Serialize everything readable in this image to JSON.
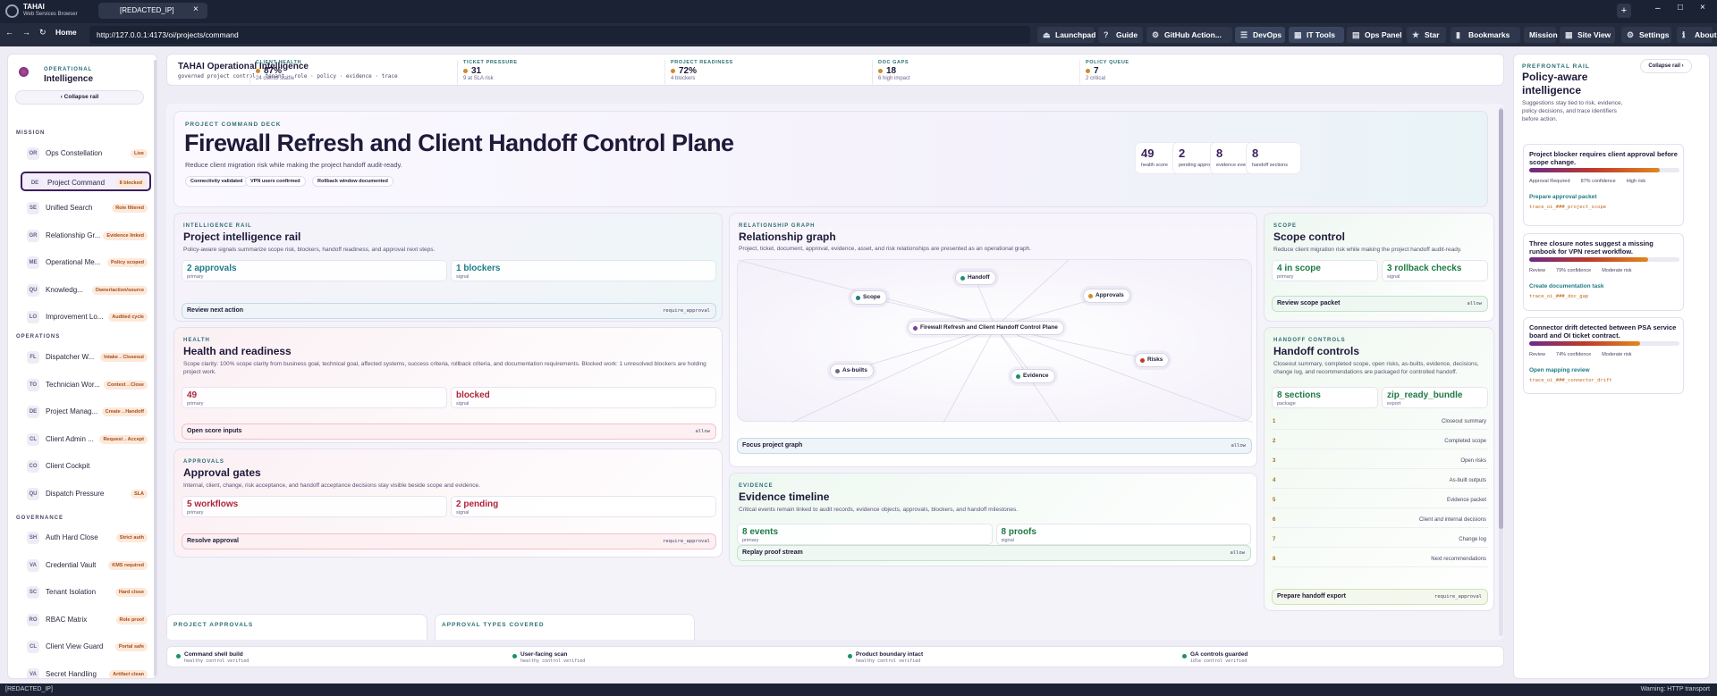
{
  "browser": {
    "app_name": "TAHAI",
    "app_sub": "Web Services Browser",
    "tab_title": "[REDACTED_IP]",
    "home": "Home",
    "url": "http://127.0.0.1:4173/oi/projects/command",
    "buttons": [
      "Launchpad",
      "Guide",
      "GitHub Action...",
      "DevOps",
      "IT Tools",
      "Ops Panel",
      "Star",
      "Bookmarks",
      "Mission",
      "Site View",
      "Settings",
      "About"
    ],
    "status_left": "[REDACTED_IP]",
    "status_right": "Warning: HTTP transport"
  },
  "sidebar": {
    "brand_small": "OPERATIONAL",
    "brand_big": "Intelligence",
    "collapse": "Collapse rail",
    "sections": {
      "mission": "MISSION",
      "operations": "OPERATIONS",
      "governance": "GOVERNANCE"
    },
    "mission": [
      {
        "ab": "OR",
        "label": "Ops Constellation",
        "badge": "Live"
      },
      {
        "ab": "DE",
        "label": "Project Command",
        "badge": "8 blocked"
      },
      {
        "ab": "SE",
        "label": "Unified Search",
        "badge": "Role filtered"
      },
      {
        "ab": "GR",
        "label": "Relationship Gr...",
        "badge": "Evidence linked"
      },
      {
        "ab": "ME",
        "label": "Operational Me...",
        "badge": "Policy scoped"
      },
      {
        "ab": "QU",
        "label": "Knowledg...",
        "badge": "Owner/action/source"
      },
      {
        "ab": "LO",
        "label": "Improvement Lo...",
        "badge": "Audited cycle"
      }
    ],
    "operations": [
      {
        "ab": "FL",
        "label": "Dispatcher W...",
        "badge": "Intake→Closeout"
      },
      {
        "ab": "TO",
        "label": "Technician Wor...",
        "badge": "Context→Close"
      },
      {
        "ab": "DE",
        "label": "Project Manag...",
        "badge": "Create→Handoff"
      },
      {
        "ab": "CL",
        "label": "Client Admin ...",
        "badge": "Request→Accept"
      },
      {
        "ab": "CO",
        "label": "Client Cockpit",
        "badge": ""
      },
      {
        "ab": "QU",
        "label": "Dispatch Pressure",
        "badge": "SLA"
      }
    ],
    "governance": [
      {
        "ab": "SH",
        "label": "Auth Hard Close",
        "badge": "Strict auth"
      },
      {
        "ab": "VA",
        "label": "Credential Vault",
        "badge": "KMS required"
      },
      {
        "ab": "SC",
        "label": "Tenant Isolation",
        "badge": "Hard close"
      },
      {
        "ab": "RO",
        "label": "RBAC Matrix",
        "badge": "Role proof"
      },
      {
        "ab": "CL",
        "label": "Client View Guard",
        "badge": "Portal safe"
      },
      {
        "ab": "VA",
        "label": "Secret Handling",
        "badge": "Artifact clean"
      }
    ]
  },
  "header": {
    "title": "TAHAI Operational Intelligence",
    "subtitle": "governed project control · tenant · role · policy · evidence · trace",
    "kpis": [
      {
        "k": "CLIENT HEALTH",
        "v": "87%",
        "s": "24 clients stable"
      },
      {
        "k": "TICKET PRESSURE",
        "v": "31",
        "s": "9 at SLA risk"
      },
      {
        "k": "PROJECT READINESS",
        "v": "72%",
        "s": "4 blockers"
      },
      {
        "k": "DOC GAPS",
        "v": "18",
        "s": "6 high impact"
      },
      {
        "k": "POLICY QUEUE",
        "v": "7",
        "s": "2 critical"
      }
    ]
  },
  "hero": {
    "cap": "PROJECT COMMAND DECK",
    "title": "Firewall Refresh and Client Handoff Control Plane",
    "desc": "Reduce client migration risk while making the project handoff audit-ready.",
    "chips": [
      "Connectivity validated",
      "VPN users confirmed",
      "Rollback window documented"
    ],
    "stats": [
      {
        "v": "49",
        "l": "health score"
      },
      {
        "v": "2",
        "l": "pending approvals"
      },
      {
        "v": "8",
        "l": "evidence events"
      },
      {
        "v": "8",
        "l": "handoff sections"
      }
    ]
  },
  "intel": {
    "cap": "INTELLIGENCE RAIL",
    "title": "Project intelligence rail",
    "desc": "Policy-aware signals summarize scope risk, blockers, handoff readiness, and approval next steps.",
    "m1v": "2 approvals",
    "m1s": "primary",
    "m2v": "1 blockers",
    "m2s": "signal",
    "action": "Review next action",
    "decision": "require_approval"
  },
  "health": {
    "cap": "HEALTH",
    "title": "Health and readiness",
    "desc": "Scope clarity: 100% scope clarity from business goal, technical goal, affected systems, success criteria, rollback criteria, and documentation requirements. Blocked work: 1 unresolved blockers are holding project work.",
    "m1v": "49",
    "m1s": "primary",
    "m2v": "blocked",
    "m2s": "signal",
    "action": "Open score inputs",
    "decision": "allow"
  },
  "approvals": {
    "cap": "APPROVALS",
    "title": "Approval gates",
    "desc": "Internal, client, change, risk acceptance, and handoff acceptance decisions stay visible beside scope and evidence.",
    "m1v": "5 workflows",
    "m1s": "primary",
    "m2v": "2 pending",
    "m2s": "signal",
    "action": "Resolve approval",
    "decision": "require_approval"
  },
  "graph": {
    "cap": "RELATIONSHIP GRAPH",
    "title": "Relationship graph",
    "desc": "Project, ticket, document, approval, evidence, asset, and risk relationships are presented as an operational graph.",
    "center": "Firewall Refresh and Client Handoff Control Plane",
    "nodes": {
      "handoff": "Handoff",
      "scope": "Scope",
      "approvals": "Approvals",
      "risks": "Risks",
      "asbuilts": "As-builts",
      "evidence": "Evidence"
    },
    "action": "Focus project graph",
    "decision": "allow"
  },
  "timeline": {
    "cap": "EVIDENCE",
    "title": "Evidence timeline",
    "desc": "Critical events remain linked to audit records, evidence objects, approvals, blockers, and handoff milestones.",
    "m1v": "8 events",
    "m1s": "primary",
    "m2v": "8 proofs",
    "m2s": "signal",
    "action": "Replay proof stream",
    "decision": "allow"
  },
  "scope": {
    "cap": "SCOPE",
    "title": "Scope control",
    "desc": "Reduce client migration risk while making the project handoff audit-ready.",
    "m1v": "4 in scope",
    "m1s": "primary",
    "m2v": "3 rollback checks",
    "m2s": "signal",
    "action": "Review scope packet",
    "decision": "allow"
  },
  "handoff": {
    "cap": "HANDOFF CONTROLS",
    "title": "Handoff controls",
    "desc": "Closeout summary, completed scope, open risks, as-builts, evidence, decisions, change log, and recommendations are packaged for controlled handoff.",
    "m1v": "8 sections",
    "m1s": "package",
    "m2v": "zip_ready_bundle",
    "m2s": "export",
    "rows": [
      {
        "n": "1",
        "t": "Closeout summary"
      },
      {
        "n": "2",
        "t": "Completed scope"
      },
      {
        "n": "3",
        "t": "Open risks"
      },
      {
        "n": "4",
        "t": "As-built outputs"
      },
      {
        "n": "5",
        "t": "Evidence packet"
      },
      {
        "n": "6",
        "t": "Client and internal decisions"
      },
      {
        "n": "7",
        "t": "Change log"
      },
      {
        "n": "8",
        "t": "Next recommendations"
      }
    ],
    "action": "Prepare handoff export",
    "decision": "require_approval"
  },
  "lower": {
    "a": "PROJECT APPROVALS",
    "b": "APPROVAL TYPES COVERED"
  },
  "checks": [
    {
      "l": "Command shell build",
      "s": "healthy control verified"
    },
    {
      "l": "User-facing scan",
      "s": "healthy control verified"
    },
    {
      "l": "Product boundary intact",
      "s": "healthy control verified"
    },
    {
      "l": "GA controls guarded",
      "s": "idle control verified"
    }
  ],
  "rail": {
    "cap": "PREFRONTAL RAIL",
    "title": "Policy-aware intelligence",
    "collapse": "Collapse rail",
    "desc": "Suggestions stay tied to risk, evidence, policy decisions, and trace identifiers before action.",
    "suggestions": [
      {
        "title": "Project blocker requires client approval before scope change.",
        "confidence": 0.87,
        "m1": "Approval Required",
        "m2": "87% confidence",
        "m3": "High risk",
        "link": "Prepare approval packet",
        "trace": "trace_oi_###_project_scope"
      },
      {
        "title": "Three closure notes suggest a missing runbook for VPN reset workflow.",
        "confidence": 0.79,
        "m1": "Review",
        "m2": "79% confidence",
        "m3": "Moderate risk",
        "link": "Create documentation task",
        "trace": "trace_oi_###_doc_gap"
      },
      {
        "title": "Connector drift detected between PSA service board and OI ticket contract.",
        "confidence": 0.74,
        "m1": "Review",
        "m2": "74% confidence",
        "m3": "Moderate risk",
        "link": "Open mapping review",
        "trace": "trace_oi_###_connector_drift"
      }
    ]
  },
  "colors": {
    "accent": "#2b6f74",
    "brand": "#3b1f5c",
    "warn": "#a44d1b"
  }
}
